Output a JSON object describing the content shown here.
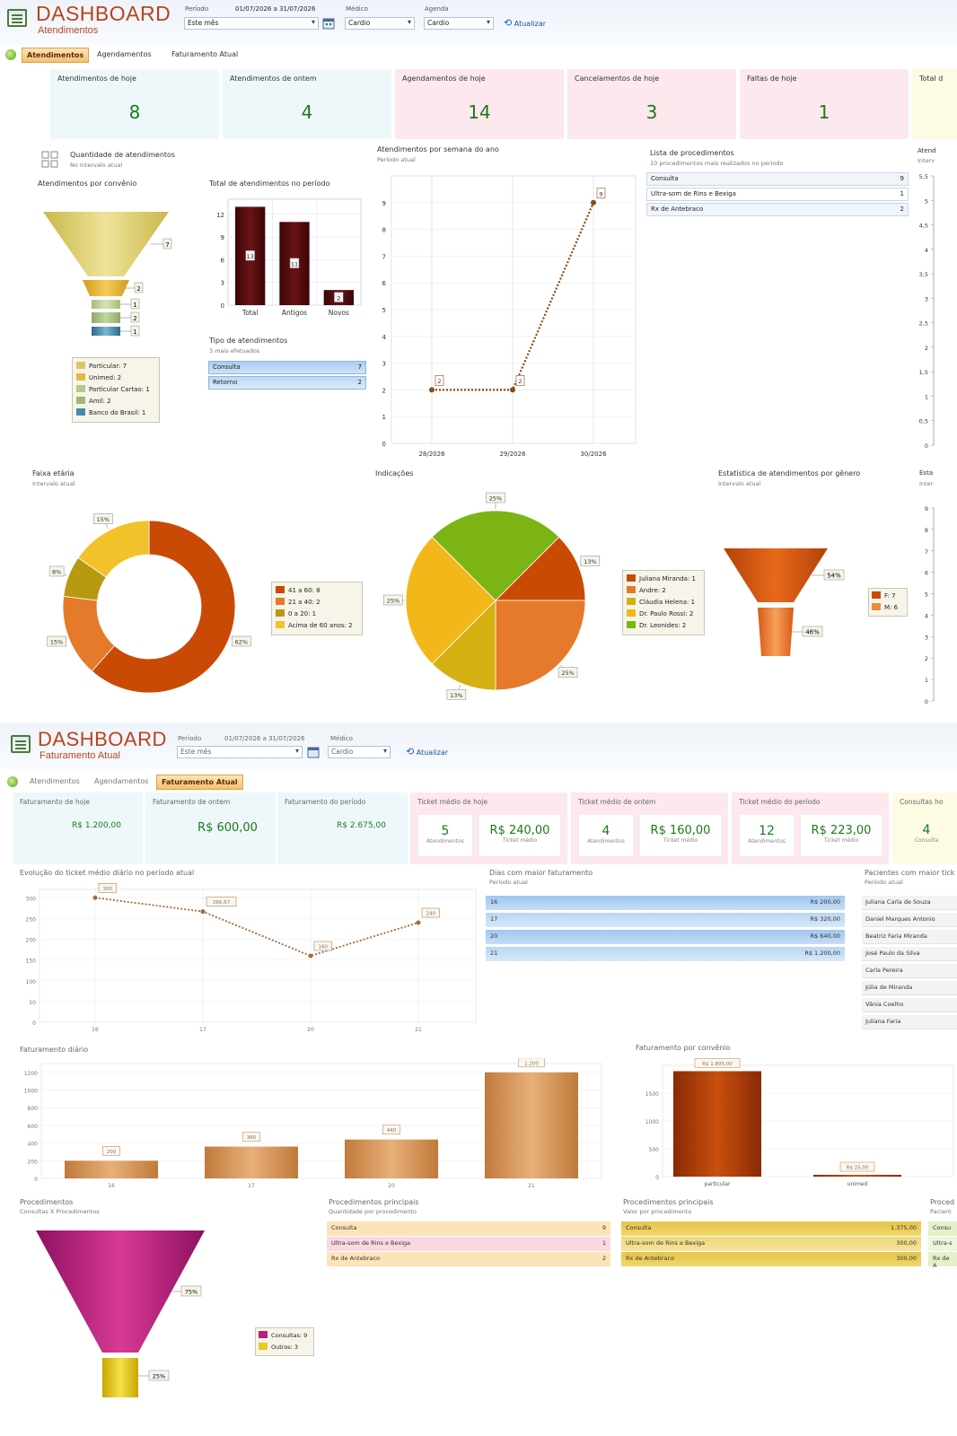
{
  "panel1": {
    "header": {
      "title": "DASHBOARD",
      "subtitle": "Atendimentos",
      "period_label": "Período",
      "period_range": "01/07/2026 a 31/07/2026",
      "period_value": "Este mês",
      "doctor_label": "Médico",
      "doctor_value": "Cardio",
      "agenda_label": "Agenda",
      "agenda_value": "Cardio",
      "refresh_label": "Atualizar"
    },
    "tabs": [
      {
        "label": "Atendimentos",
        "active": true
      },
      {
        "label": "Agendamentos",
        "active": false
      },
      {
        "label": "Faturamento Atual",
        "active": false
      }
    ],
    "cards": [
      {
        "title": "Atendimentos de hoje",
        "value": "8",
        "bg": "#eef8fb"
      },
      {
        "title": "Atendimentos de ontem",
        "value": "4",
        "bg": "#eef8fb"
      },
      {
        "title": "Agendamentos de hoje",
        "value": "14",
        "bg": "#fde8ee"
      },
      {
        "title": "Cancelamentos de hoje",
        "value": "3",
        "bg": "#fde8ee"
      },
      {
        "title": "Faltas de hoje",
        "value": "1",
        "bg": "#fde8ee"
      },
      {
        "title": "Total d",
        "value": "",
        "bg": "#fdfbe4"
      }
    ],
    "qty_box": {
      "title": "Quantidade de atendimentos",
      "subtitle": "No intervalo atual"
    },
    "funnel_convenio": {
      "title": "Atendimentos por convênio",
      "values": [
        "7",
        "2",
        "1",
        "2",
        "1"
      ],
      "legend": [
        "Particular: 7",
        "Unimed: 2",
        "Particular Cartao: 1",
        "Amil: 2",
        "Banco do Brasil: 1"
      ],
      "colors": [
        "#d9c766",
        "#e3b84a",
        "#b7c98a",
        "#9fb878",
        "#4a8aa8"
      ]
    },
    "total_chart": {
      "title": "Total de atendimentos no período",
      "chart_data": {
        "type": "bar",
        "categories": [
          "Total",
          "Antigos",
          "Novos"
        ],
        "values": [
          13,
          11,
          2
        ],
        "ylim": [
          0,
          14
        ],
        "yticks": [
          "0",
          "3",
          "6",
          "9",
          "12"
        ]
      }
    },
    "tipo": {
      "title": "Tipo de atendimentos",
      "subtitle": "3 mais efetuados",
      "rows": [
        {
          "label": "Consulta",
          "value": "7"
        },
        {
          "label": "Retorno",
          "value": "2"
        }
      ]
    },
    "semana_chart": {
      "title": "Atendimentos por semana do ano",
      "subtitle": "Período atual",
      "chart_data": {
        "type": "line",
        "x": [
          "28/2026",
          "29/2026",
          "30/2026"
        ],
        "values": [
          2,
          2,
          9
        ],
        "ylim": [
          0,
          10
        ],
        "yticks": [
          "0",
          "1",
          "2",
          "3",
          "4",
          "5",
          "6",
          "7",
          "8",
          "9"
        ]
      }
    },
    "procedimentos": {
      "title": "Lista de procedimentos",
      "subtitle": "10 procedimentos mais realizados no período",
      "rows": [
        {
          "label": "Consulta",
          "value": "9"
        },
        {
          "label": "Ultra-som de Rins e Bexiga",
          "value": "1"
        },
        {
          "label": "Rx de Antebraco",
          "value": "2"
        }
      ]
    },
    "right_axis": {
      "title": "Atend",
      "sub": "Interv",
      "ticks": [
        "5,5",
        "5",
        "4,5",
        "4",
        "3,5",
        "3",
        "2,5",
        "2",
        "1,5",
        "1",
        "0,5",
        "0"
      ]
    },
    "faixa_etaria": {
      "title": "Faixa etária",
      "subtitle": "Intervalo atual",
      "chart_data": {
        "type": "pie",
        "labels": [
          "41 a 60",
          "21 a 40",
          "0 a 20",
          "Acima de 60 anos"
        ],
        "values": [
          8,
          2,
          1,
          2
        ],
        "percent_labels": [
          "62%",
          "15%",
          "8%",
          "15%"
        ],
        "colors": [
          "#c94a05",
          "#e57a2a",
          "#b89a10",
          "#f2c22a"
        ]
      },
      "legend": [
        "41 a 60: 8",
        "21 a 40: 2",
        "0 a 20: 1",
        "Acima de 60 anos: 2"
      ]
    },
    "indicacoes": {
      "title": "Indicações",
      "chart_data": {
        "type": "pie",
        "labels": [
          "Juliana Miranda",
          "Andre",
          "Cláudia Helena",
          "Dr. Paulo Rossi",
          "Dr. Leonides"
        ],
        "values": [
          1,
          2,
          1,
          2,
          2
        ],
        "percent_labels": [
          "13%",
          "25%",
          "13%",
          "25%",
          "25%"
        ],
        "colors": [
          "#c94a05",
          "#e57a2a",
          "#d4b012",
          "#f2b81a",
          "#7cb414"
        ]
      },
      "legend": [
        "Juliana Miranda: 1",
        "Andre: 2",
        "Cláudia Helena: 1",
        "Dr. Paulo Rossi: 2",
        "Dr. Leonides: 2"
      ]
    },
    "genero": {
      "title": "Estatística de atendimentos por gênero",
      "subtitle": "Intervalo atual",
      "values": [
        "54%",
        "46%"
      ],
      "legend": [
        "F: 7",
        "M: 6"
      ]
    },
    "right_axis2": {
      "title": "Esta",
      "sub": "Inter",
      "ticks": [
        "9",
        "8",
        "7",
        "6",
        "5",
        "4",
        "3",
        "2",
        "1",
        "0"
      ]
    }
  },
  "panel2": {
    "header": {
      "title": "DASHBOARD",
      "subtitle": "Faturamento Atual",
      "period_label": "Período",
      "period_range": "01/07/2026 a 31/07/2026",
      "period_value": "Este mês",
      "doctor_label": "Médico",
      "doctor_value": "Cardio",
      "refresh_label": "Atualizar"
    },
    "tabs": [
      {
        "label": "Atendimentos",
        "active": false
      },
      {
        "label": "Agendamentos",
        "active": false
      },
      {
        "label": "Faturamento Atual",
        "active": true
      }
    ],
    "cards": [
      {
        "title": "Faturamento de hoje",
        "value": "R$ 1.200,00"
      },
      {
        "title": "Faturamento de ontem",
        "value": "R$ 600,00"
      },
      {
        "title": "Faturamento do período",
        "value": "R$ 2.675,00"
      }
    ],
    "ticket_cards": [
      {
        "title": "Ticket médio de hoje",
        "count": "5",
        "count_label": "Atendimentos",
        "value": "R$ 240,00",
        "value_label": "Ticket médio"
      },
      {
        "title": "Ticket médio de ontem",
        "count": "4",
        "count_label": "Atendimentos",
        "value": "R$ 160,00",
        "value_label": "Ticket médio"
      },
      {
        "title": "Ticket médio do período",
        "count": "12",
        "count_label": "Atendimentos",
        "value": "R$ 223,00",
        "value_label": "Ticket médio"
      },
      {
        "title": "Consultas ho",
        "count": "4",
        "count_label": "Consulta",
        "value": "",
        "value_label": ""
      }
    ],
    "ticket_chart": {
      "title": "Evolução do ticket médio diário no período atual",
      "chart_data": {
        "type": "line",
        "x": [
          "16",
          "17",
          "20",
          "21"
        ],
        "values": [
          300,
          266.67,
          160,
          240
        ],
        "labels": [
          "300",
          "266,67",
          "160",
          "240"
        ],
        "ylim": [
          0,
          320
        ],
        "yticks": [
          "0",
          "50",
          "100",
          "150",
          "200",
          "250",
          "300"
        ]
      }
    },
    "dias": {
      "title": "Dias com maior faturamento",
      "subtitle": "Período atual",
      "rows": [
        {
          "label": "16",
          "value": "R$ 200,00"
        },
        {
          "label": "17",
          "value": "R$ 320,00"
        },
        {
          "label": "20",
          "value": "R$ 640,00"
        },
        {
          "label": "21",
          "value": "R$ 1.200,00"
        }
      ]
    },
    "pacientes": {
      "title": "Pacientes com maior tick",
      "subtitle": "Período atual",
      "rows": [
        "Juliana Carla de Souza",
        "Daniel Marques Antonio",
        "Beatriz Faria Miranda",
        "José Paulo da Silva",
        "Carla Pereira",
        "Júlia de Miranda",
        "Vânia Coelho",
        "Juliana Faria"
      ]
    },
    "fat_diario": {
      "title": "Faturamento diário",
      "chart_data": {
        "type": "bar",
        "categories": [
          "16",
          "17",
          "20",
          "21"
        ],
        "values": [
          200,
          360,
          440,
          1200
        ],
        "labels": [
          "200",
          "360",
          "440",
          "1.200"
        ],
        "ylim": [
          0,
          1300
        ],
        "yticks": [
          "0",
          "200",
          "400",
          "600",
          "800",
          "1000",
          "1200"
        ]
      }
    },
    "fat_convenio": {
      "title": "Faturamento por convênio",
      "chart_data": {
        "type": "bar",
        "categories": [
          "particular",
          "unimed"
        ],
        "values": [
          1895,
          25
        ],
        "labels": [
          "R$ 1.895,00",
          "R$ 25,00"
        ],
        "ylim": [
          0,
          2000
        ],
        "yticks": [
          "0",
          "500",
          "1000",
          "1500"
        ]
      }
    },
    "proc_funnel": {
      "title": "Procedimentos",
      "subtitle": "Consultas X Procedimentos",
      "values": [
        "75%",
        "25%"
      ],
      "legend": [
        "Consultas: 9",
        "Outros: 3"
      ]
    },
    "proc_qtd": {
      "title": "Procedimentos principais",
      "subtitle": "Quantidade por procedimento",
      "rows": [
        {
          "label": "Consulta",
          "value": "9"
        },
        {
          "label": "Ultra-som de Rins e Bexiga",
          "value": "1"
        },
        {
          "label": "Rx de Antebraco",
          "value": "2"
        }
      ]
    },
    "proc_val": {
      "title": "Procedimentos principais",
      "subtitle": "Valor por procedimento",
      "rows": [
        {
          "label": "Consulta",
          "value": "1.375,00"
        },
        {
          "label": "Ultra-som de Rins e Bexiga",
          "value": "300,00"
        },
        {
          "label": "Rx de Antebraco",
          "value": "300,00"
        }
      ]
    },
    "proc_right": {
      "title": "Proced",
      "subtitle": "Pacient",
      "rows": [
        "Consu",
        "Ultra-s",
        "Rx de A"
      ]
    }
  }
}
